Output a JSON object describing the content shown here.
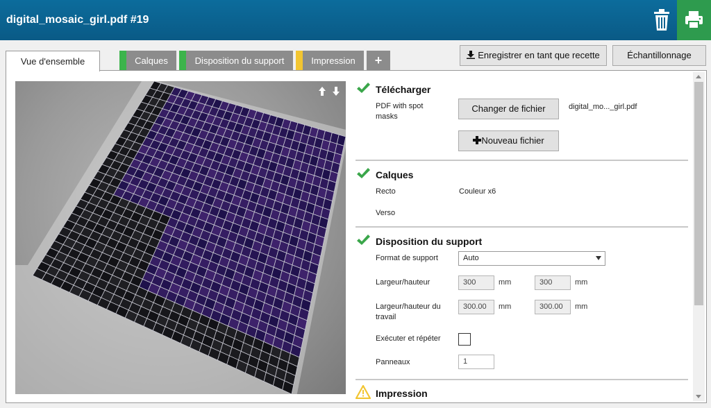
{
  "header": {
    "title": "digital_mosaic_girl.pdf #19"
  },
  "tabs": [
    {
      "label": "Vue d'ensemble"
    },
    {
      "label": "Calques",
      "status_color": "#3cb44b"
    },
    {
      "label": "Disposition du support",
      "status_color": "#3cb44b"
    },
    {
      "label": "Impression",
      "status_color": "#f2c531"
    },
    {
      "label": "+"
    }
  ],
  "toolbar": {
    "save_recipe_label": "Enregistrer en tant que recette",
    "sampling_label": "Échantillonnage"
  },
  "sections": {
    "download": {
      "title": "Télécharger",
      "pdf_label": "PDF with spot masks",
      "change_file_label": "Changer de fichier",
      "file_name": "digital_mo..._girl.pdf",
      "new_file_label": "Nouveau fichier"
    },
    "layers": {
      "title": "Calques",
      "front_label": "Recto",
      "front_value": "Couleur x6",
      "back_label": "Verso"
    },
    "layout": {
      "title": "Disposition du support",
      "format_label": "Format de support",
      "format_value": "Auto",
      "size_label": "Largeur/hauteur",
      "width_value": "300",
      "height_value": "300",
      "unit": "mm",
      "work_size_label": "Largeur/hauteur du travail",
      "work_width_value": "300.00",
      "work_height_value": "300.00",
      "step_repeat_label": "Exécuter et répéter",
      "panels_label": "Panneaux",
      "panels_value": "1"
    },
    "print": {
      "title": "Impression"
    }
  },
  "colors": {
    "header": "#0a6592",
    "print_button": "#2e9b4e",
    "check": "#3aa64a",
    "warning": "#f2c531"
  }
}
